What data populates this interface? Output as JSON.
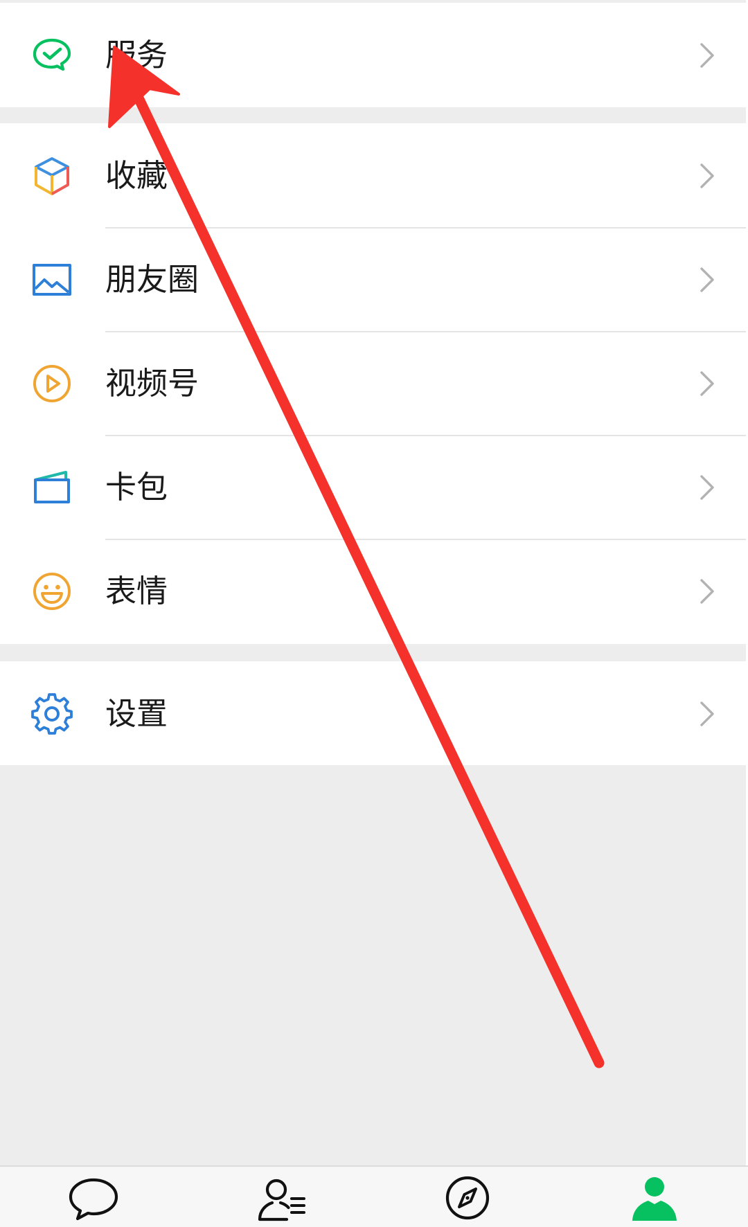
{
  "menu": {
    "service": {
      "label": "服务",
      "icon": "wechat-pay-icon"
    },
    "favorites": {
      "label": "收藏",
      "icon": "cube-icon"
    },
    "moments": {
      "label": "朋友圈",
      "icon": "picture-icon"
    },
    "channels": {
      "label": "视频号",
      "icon": "play-circle-icon"
    },
    "cards": {
      "label": "卡包",
      "icon": "card-wallet-icon"
    },
    "stickers": {
      "label": "表情",
      "icon": "smiley-icon"
    },
    "settings": {
      "label": "设置",
      "icon": "gear-icon"
    }
  },
  "tabbar": {
    "active": "me",
    "items": [
      {
        "id": "chats",
        "icon": "chat-bubble-icon"
      },
      {
        "id": "contacts",
        "icon": "contacts-icon"
      },
      {
        "id": "discover",
        "icon": "compass-icon"
      },
      {
        "id": "me",
        "icon": "person-icon"
      }
    ]
  },
  "colors": {
    "wechat_green": "#07c160",
    "annotation_red": "#f5312b",
    "background": "#ededed",
    "chevron": "#b2b2b2"
  },
  "annotation": {
    "type": "arrow",
    "color": "#f5312b"
  }
}
